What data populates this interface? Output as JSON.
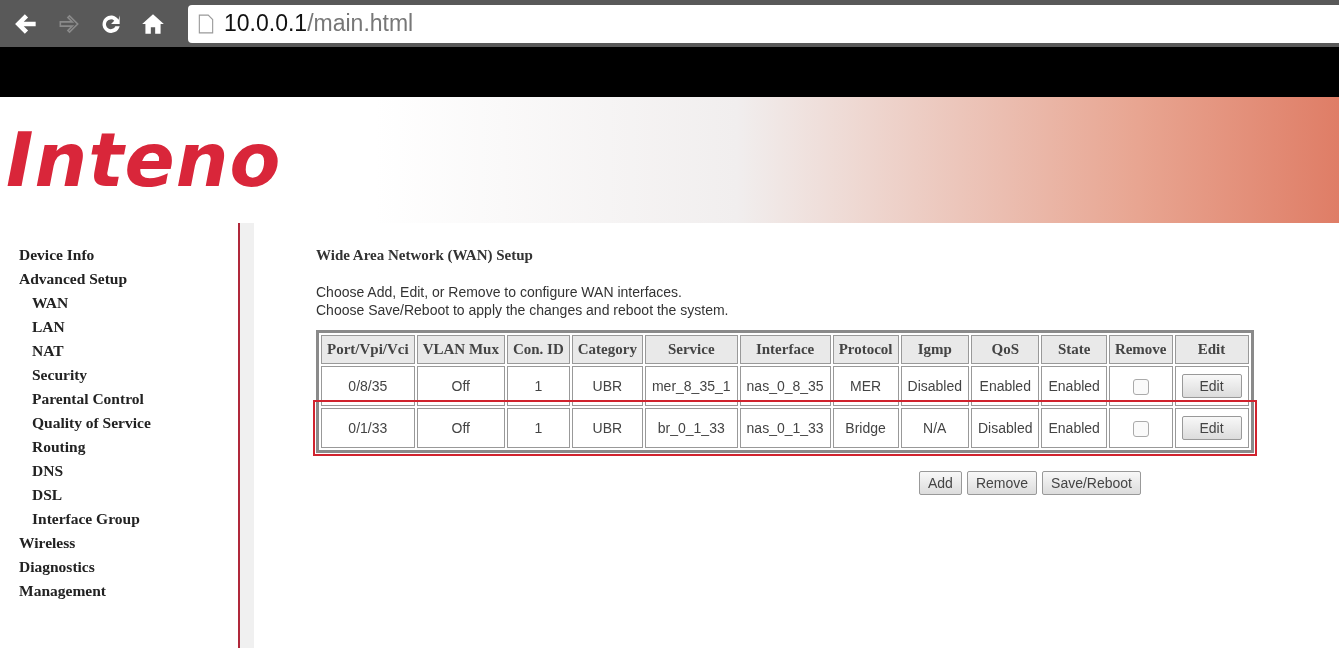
{
  "browser": {
    "url_host": "10.0.0.1",
    "url_path": "/main.html"
  },
  "header": {
    "logo": "Inteno"
  },
  "sidebar": {
    "items": [
      {
        "label": "Device Info"
      },
      {
        "label": "Advanced Setup",
        "children": [
          {
            "label": "WAN"
          },
          {
            "label": "LAN"
          },
          {
            "label": "NAT"
          },
          {
            "label": "Security"
          },
          {
            "label": "Parental Control"
          },
          {
            "label": "Quality of Service"
          },
          {
            "label": "Routing"
          },
          {
            "label": "DNS"
          },
          {
            "label": "DSL"
          },
          {
            "label": "Interface Group"
          }
        ]
      },
      {
        "label": "Wireless"
      },
      {
        "label": "Diagnostics"
      },
      {
        "label": "Management"
      }
    ]
  },
  "page": {
    "title": "Wide Area Network (WAN) Setup",
    "description": [
      "Choose Add, Edit, or Remove to configure WAN interfaces.",
      "Choose Save/Reboot to apply the changes and reboot the system."
    ]
  },
  "table": {
    "columns": [
      "Port/Vpi/Vci",
      "VLAN Mux",
      "Con. ID",
      "Category",
      "Service",
      "Interface",
      "Protocol",
      "Igmp",
      "QoS",
      "State",
      "Remove",
      "Edit"
    ],
    "rows": [
      {
        "cells": [
          "0/8/35",
          "Off",
          "1",
          "UBR",
          "mer_8_35_1",
          "nas_0_8_35",
          "MER",
          "Disabled",
          "Enabled",
          "Enabled"
        ],
        "remove": false,
        "edit": "Edit",
        "highlighted": false
      },
      {
        "cells": [
          "0/1/33",
          "Off",
          "1",
          "UBR",
          "br_0_1_33",
          "nas_0_1_33",
          "Bridge",
          "N/A",
          "Disabled",
          "Enabled"
        ],
        "remove": false,
        "edit": "Edit",
        "highlighted": true
      }
    ]
  },
  "buttons": [
    "Add",
    "Remove",
    "Save/Reboot"
  ]
}
